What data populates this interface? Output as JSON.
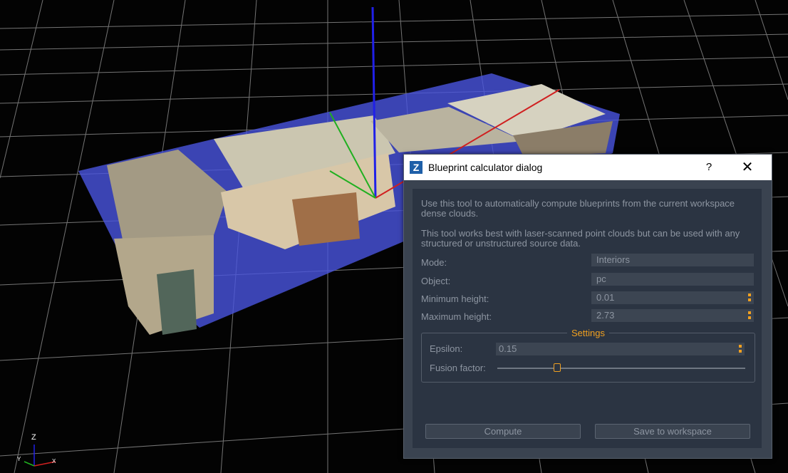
{
  "dialog": {
    "title": "Blueprint calculator dialog",
    "app_icon_letter": "Z",
    "help_label": "?",
    "close_label": "✕",
    "description_1": "Use this tool to automatically compute blueprints from the current workspace dense clouds.",
    "description_2": "This tool works best with laser-scanned point clouds but can be used with any structured or unstructured source data.",
    "mode": {
      "label": "Mode:",
      "value": "Interiors"
    },
    "object": {
      "label": "Object:",
      "value": "pc"
    },
    "min_height": {
      "label": "Minimum height:",
      "value": "0.01"
    },
    "max_height": {
      "label": "Maximum height:",
      "value": "2.73"
    },
    "settings": {
      "title": "Settings",
      "epsilon": {
        "label": "Epsilon:",
        "value": "0.15"
      },
      "fusion_factor": {
        "label": "Fusion factor:",
        "value": 0.24
      }
    },
    "compute_label": "Compute",
    "save_label": "Save to workspace"
  },
  "gizmo": {
    "z": "Z",
    "y": "Y",
    "x": "X"
  },
  "colors": {
    "accent": "#f0a020",
    "panel": "#2b3442",
    "selection": "#4a55e0"
  }
}
